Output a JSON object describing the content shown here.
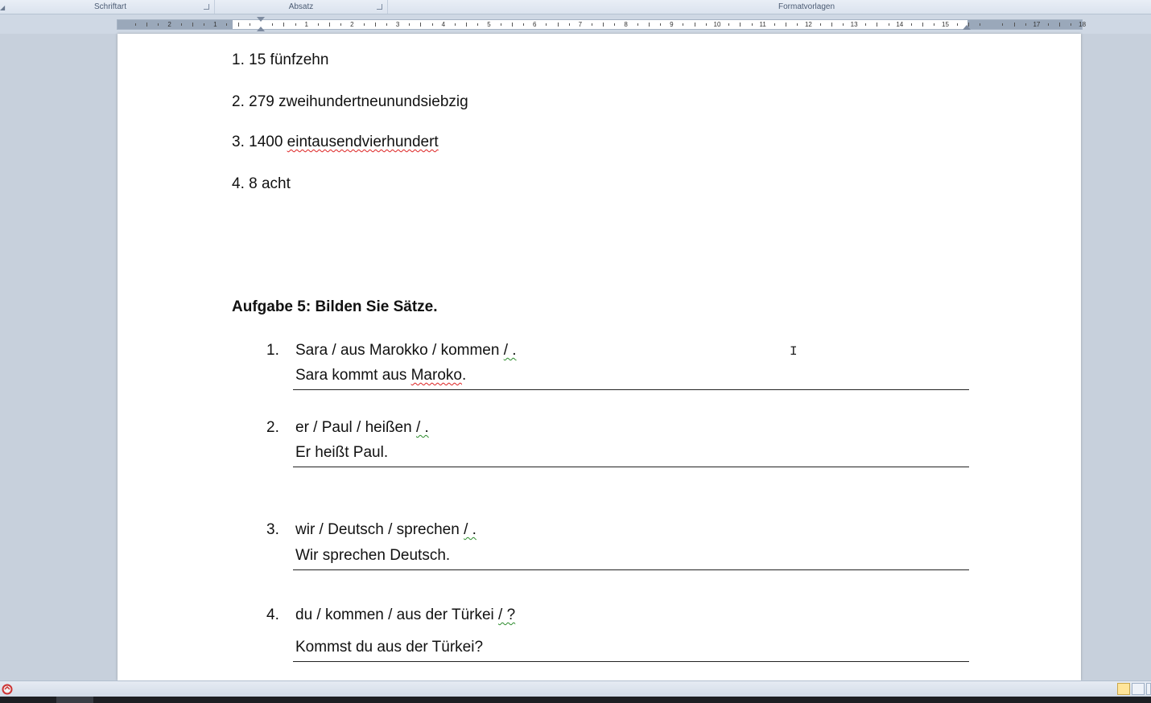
{
  "ribbon": {
    "groups": [
      {
        "label": "Schriftart"
      },
      {
        "label": "Absatz"
      },
      {
        "label": "Formatvorlagen"
      }
    ]
  },
  "ruler": {
    "numbers": [
      "2",
      "1",
      "1",
      "2",
      "3",
      "4",
      "5",
      "6",
      "7",
      "8",
      "9",
      "10",
      "11",
      "12",
      "13",
      "14",
      "15",
      "17",
      "18"
    ]
  },
  "document": {
    "numbers_list": [
      {
        "prefix": "1. 15 ",
        "word": "fünfzehn",
        "spell_error": false
      },
      {
        "prefix": "2. 279 ",
        "word": "zweihundertneunundsiebzig",
        "spell_error": false
      },
      {
        "prefix": "3. 1400 ",
        "word": "eintausendvierhundert",
        "spell_error": true
      },
      {
        "prefix": "4. 8 ",
        "word": "acht",
        "spell_error": false
      }
    ],
    "task_heading": "Aufgabe 5: Bilden Sie Sätze.",
    "exercises": [
      {
        "num": "1.",
        "prompt": "Sara / aus Marokko / kommen ",
        "prompt_end": "/ .",
        "answer_pre": "Sara kommt aus ",
        "answer_err": "Maroko",
        "answer_post": "."
      },
      {
        "num": "2.",
        "prompt": "er / Paul / heißen ",
        "prompt_end": "/ .",
        "answer_pre": "Er heißt Paul.",
        "answer_err": "",
        "answer_post": ""
      },
      {
        "num": "3.",
        "prompt": "wir / Deutsch / sprechen ",
        "prompt_end": "/ .",
        "answer_pre": "Wir sprechen Deutsch.",
        "answer_err": "",
        "answer_post": ""
      },
      {
        "num": "4.",
        "prompt": "du / kommen / aus der Türkei ",
        "prompt_end": "/ ?",
        "answer_pre": "Kommst du aus der Türkei?",
        "answer_err": "",
        "answer_post": ""
      }
    ]
  },
  "colors": {
    "spelling_underline": "#d22222",
    "grammar_underline": "#2a8a2a",
    "app_background": "#c7d0dc"
  },
  "icons": {
    "status_icon": "office-status-icon",
    "text_cursor": "i-beam-cursor-icon"
  }
}
